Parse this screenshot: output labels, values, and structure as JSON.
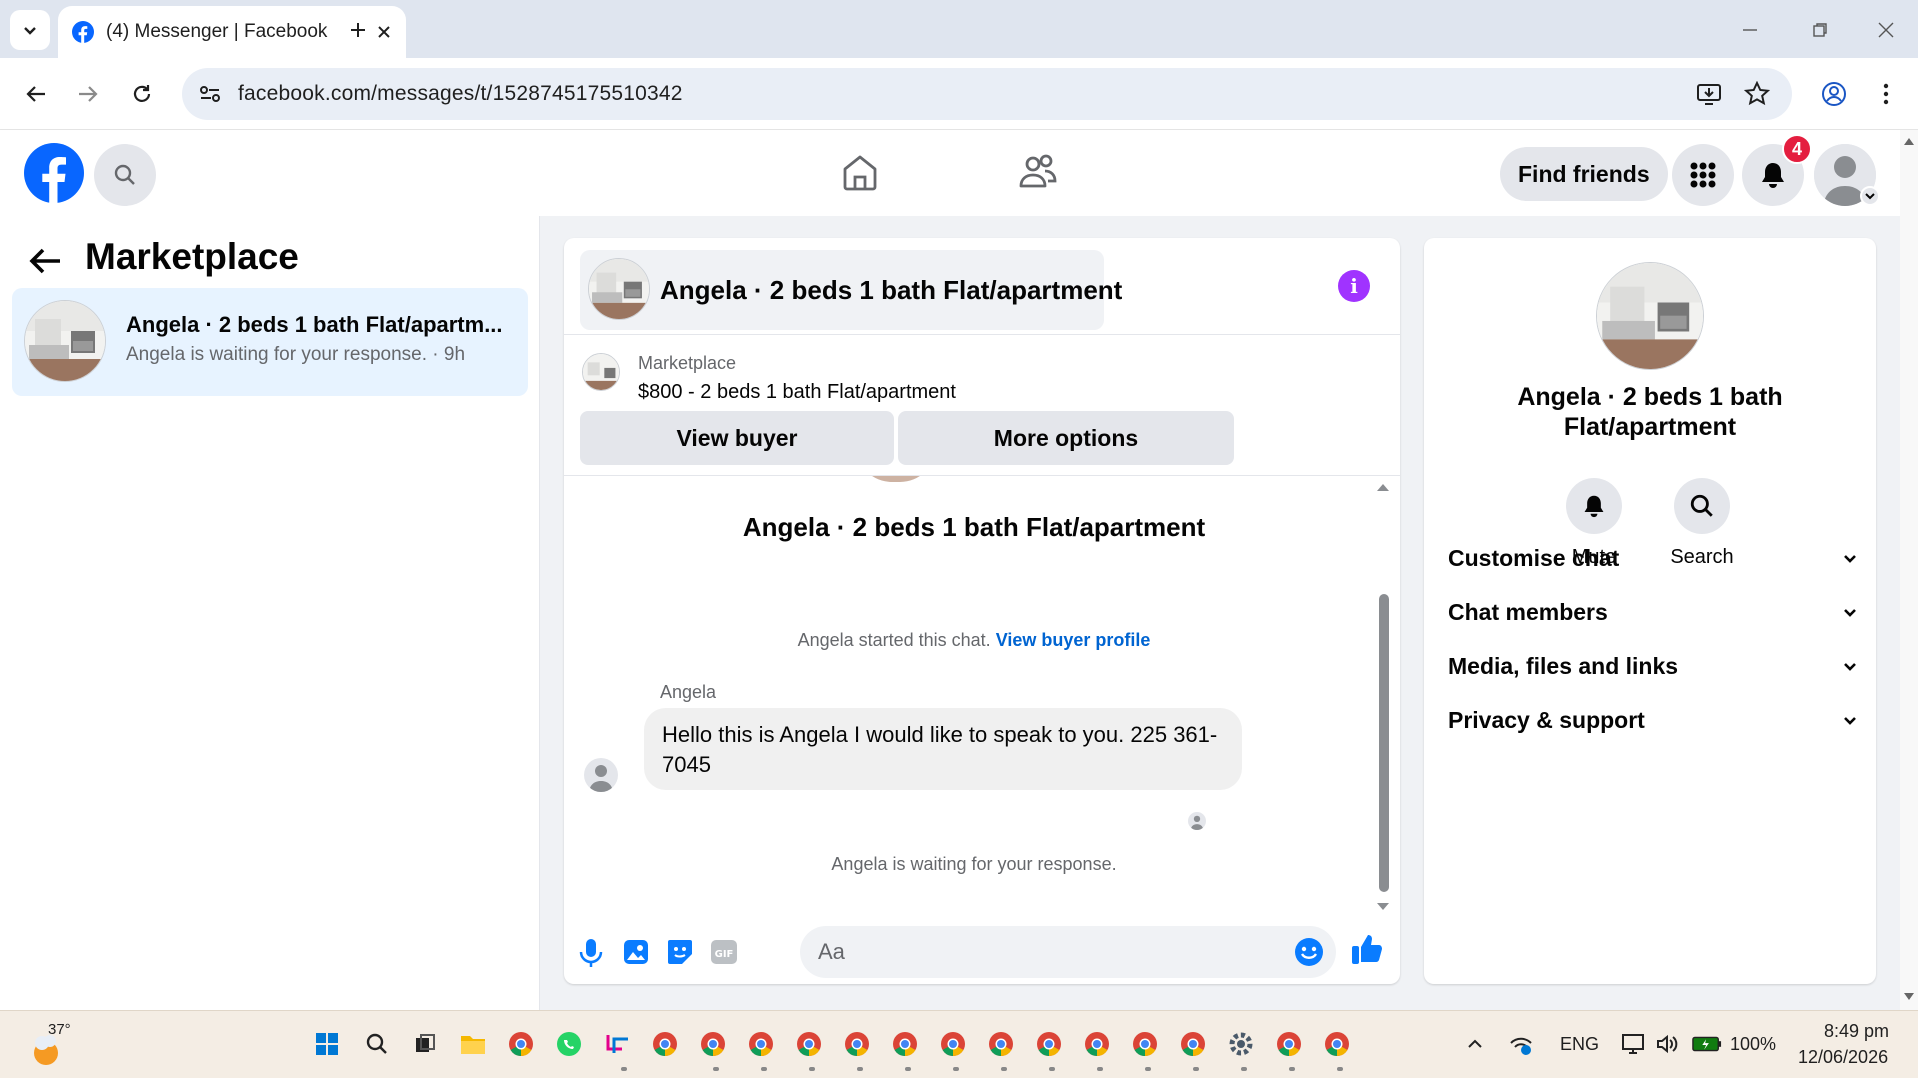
{
  "browser": {
    "tab_title": "(4) Messenger | Facebook",
    "url": "facebook.com/messages/t/1528745175510342"
  },
  "fb_header": {
    "find_friends": "Find friends",
    "notification_count": "4"
  },
  "left_panel": {
    "title": "Marketplace",
    "conversation": {
      "name": "Angela · 2 beds 1 bath Flat/apartm...",
      "subtitle": "Angela is waiting for your response. · 9h"
    }
  },
  "chat": {
    "title": "Angela · 2 beds 1 bath Flat/apartment",
    "listing": {
      "label": "Marketplace",
      "price_title": "$800 - 2 beds 1 bath Flat/apartment",
      "view_buyer": "View buyer",
      "more_options": "More options"
    },
    "thread_title": "Angela · 2 beds 1 bath Flat/apartment",
    "started_text": "Angela started this chat.",
    "view_buyer_profile": "View buyer profile",
    "sender": "Angela",
    "message": "Hello this is Angela I would like to speak to you. 225 361-7045",
    "waiting_text": "Angela is waiting for your response.",
    "input_placeholder": "Aa"
  },
  "info_panel": {
    "name": "Angela · 2 beds 1 bath Flat/apartment",
    "mute": "Mute",
    "search": "Search",
    "sections": [
      "Customise chat",
      "Chat members",
      "Media, files and links",
      "Privacy & support"
    ]
  },
  "taskbar": {
    "temperature": "37°",
    "language": "ENG",
    "battery": "100%",
    "time": "8:49 pm",
    "date": "12/06/2026"
  },
  "colors": {
    "facebook_blue": "#0866ff",
    "messenger_blue": "#0a7cff",
    "badge_red": "#e41e3f",
    "info_purple": "#a033ff"
  }
}
